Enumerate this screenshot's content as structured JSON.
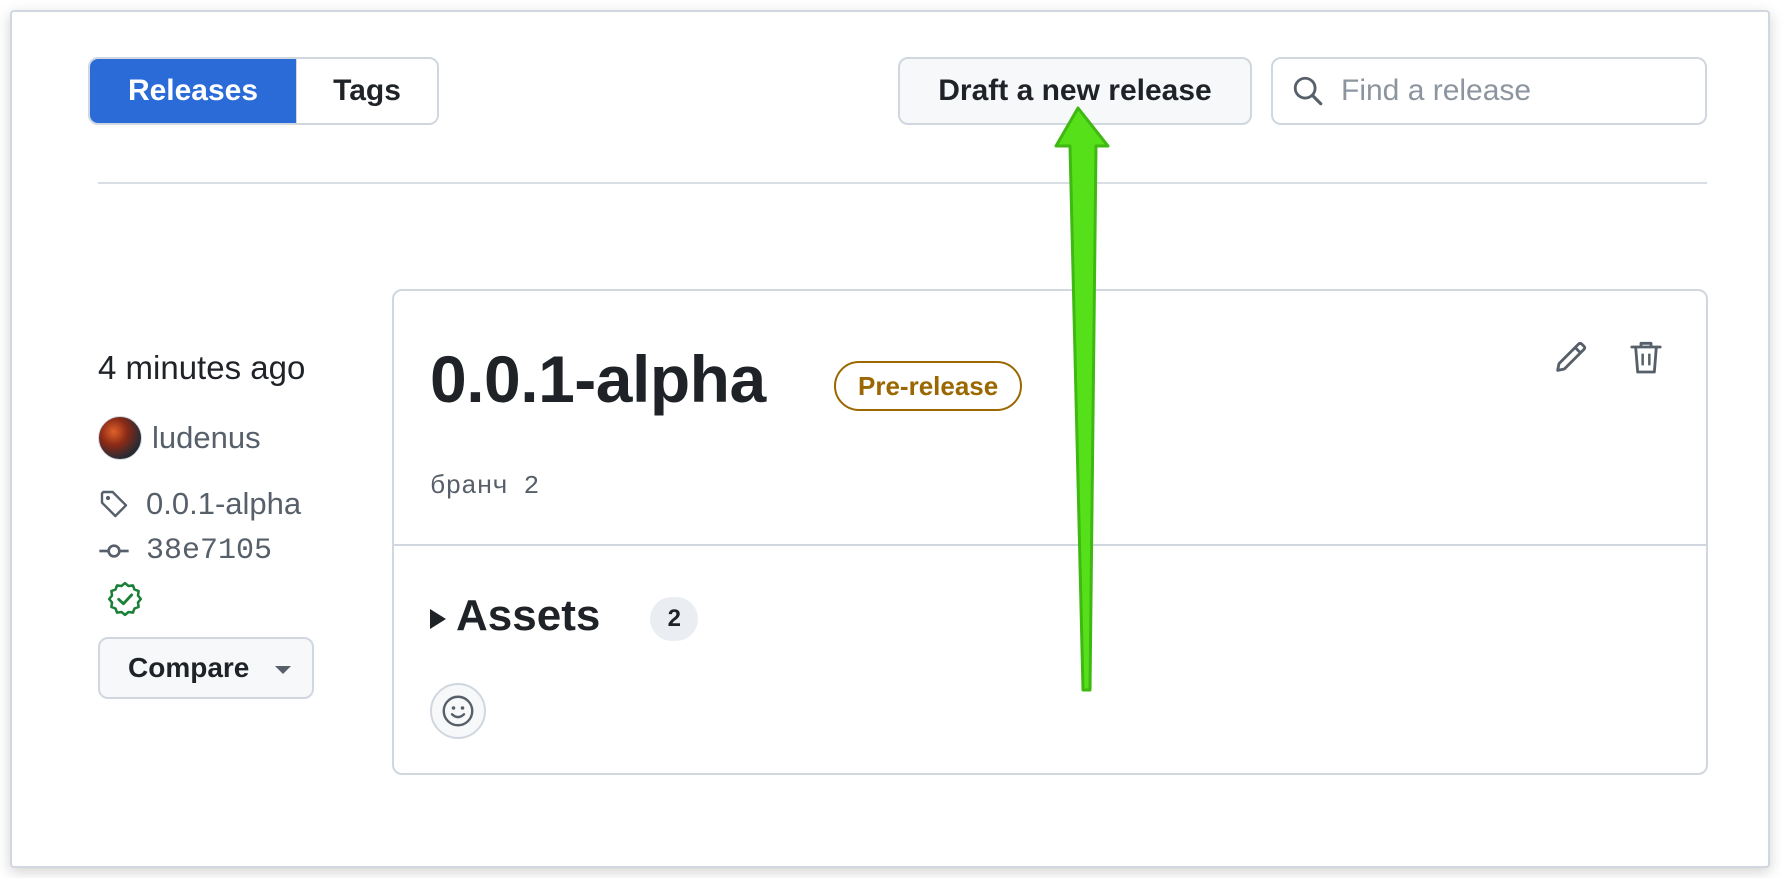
{
  "tabs": {
    "releases_label": "Releases",
    "tags_label": "Tags",
    "active": "Releases"
  },
  "toolbar": {
    "draft_label": "Draft a new release",
    "search_placeholder": "Find a release"
  },
  "release": {
    "time_ago": "4 minutes ago",
    "author": "ludenus",
    "tag": "0.0.1-alpha",
    "commit": "38e7105",
    "compare_label": "Compare",
    "title": "0.0.1-alpha",
    "badge": "Pre-release",
    "body": "бранч 2",
    "assets_label": "Assets",
    "assets_count": "2"
  },
  "icons": [
    "search-icon",
    "tag-icon",
    "commit-icon",
    "verified-icon",
    "pencil-icon",
    "trash-icon",
    "smiley-icon",
    "chevron-down-icon",
    "triangle-right-icon"
  ],
  "colors": {
    "accent": "#2a6bd8",
    "prerelease": "#9a6700",
    "verified": "#1a7f37",
    "annotation_arrow": "#55e01a"
  }
}
